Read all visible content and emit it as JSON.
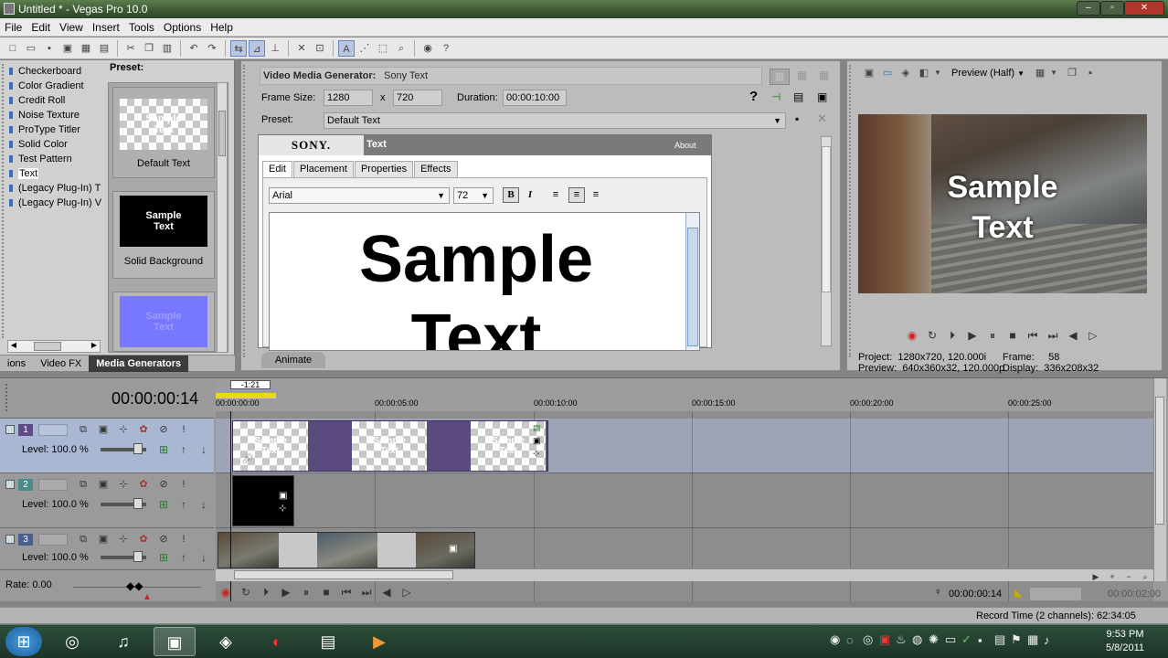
{
  "window": {
    "title": "Untitled * - Vegas Pro 10.0"
  },
  "menu": [
    "File",
    "Edit",
    "View",
    "Insert",
    "Tools",
    "Options",
    "Help"
  ],
  "left": {
    "generators": [
      "Checkerboard",
      "Color Gradient",
      "Credit Roll",
      "Noise Texture",
      "ProType Titler",
      "Solid Color",
      "Test Pattern",
      "Text",
      "(Legacy Plug-In) T",
      "(Legacy Plug-In) V"
    ],
    "selected": "Text",
    "preset_label": "Preset:",
    "presets": [
      {
        "name": "Default Text",
        "thumb": "Sample\nText"
      },
      {
        "name": "Solid Background",
        "thumb": "Sample\nText"
      },
      {
        "name": "",
        "thumb": "Sample\nText"
      }
    ],
    "tabs": [
      "ions",
      "Video FX",
      "Media Generators"
    ],
    "active_tab": "Media Generators"
  },
  "generator": {
    "title": "Video Media Generator:",
    "plugin": "Sony Text",
    "frame_size_label": "Frame Size:",
    "width": "1280",
    "x": "x",
    "height": "720",
    "duration_label": "Duration:",
    "duration": "00:00:10:00",
    "preset_label": "Preset:",
    "preset": "Default Text",
    "sony": "SONY.",
    "panel_title": "Text",
    "about": "About",
    "tabs": [
      "Edit",
      "Placement",
      "Properties",
      "Effects"
    ],
    "active_tab": "Edit",
    "font": "Arial",
    "size": "72",
    "bold": "B",
    "italic": "I",
    "text_line1": "Sample",
    "text_line2": "Text",
    "animate": "Animate"
  },
  "preview": {
    "mode": "Preview (Half)",
    "overlay_line1": "Sample",
    "overlay_line2": "Text",
    "project_label": "Project:",
    "project": "1280x720, 120.000i",
    "preview_label": "Preview:",
    "preview_val": "640x360x32, 120.000p",
    "frame_label": "Frame:",
    "frame": "58",
    "display_label": "Display:",
    "display": "336x208x32"
  },
  "timeline": {
    "timecode": "00:00:00:14",
    "loop_marker": "-1:21",
    "ruler": [
      "00:00:00:00",
      "00:00:05:00",
      "00:00:10:00",
      "00:00:15:00",
      "00:00:20:00",
      "00:00:25:00"
    ],
    "tracks": [
      {
        "num": "1",
        "level": "Level: 100.0 %"
      },
      {
        "num": "2",
        "level": "Level: 100.0 %"
      },
      {
        "num": "3",
        "level": "Level: 100.0 %"
      }
    ],
    "clip_text": "Sample\nText",
    "rate": "Rate: 0.00",
    "cursor_time": "00:00:00:14",
    "end_time": "00:00:02:00"
  },
  "status": {
    "record": "Record Time (2 channels): 62:34:05"
  },
  "clock": {
    "time": "9:53 PM",
    "date": "5/8/2011"
  }
}
